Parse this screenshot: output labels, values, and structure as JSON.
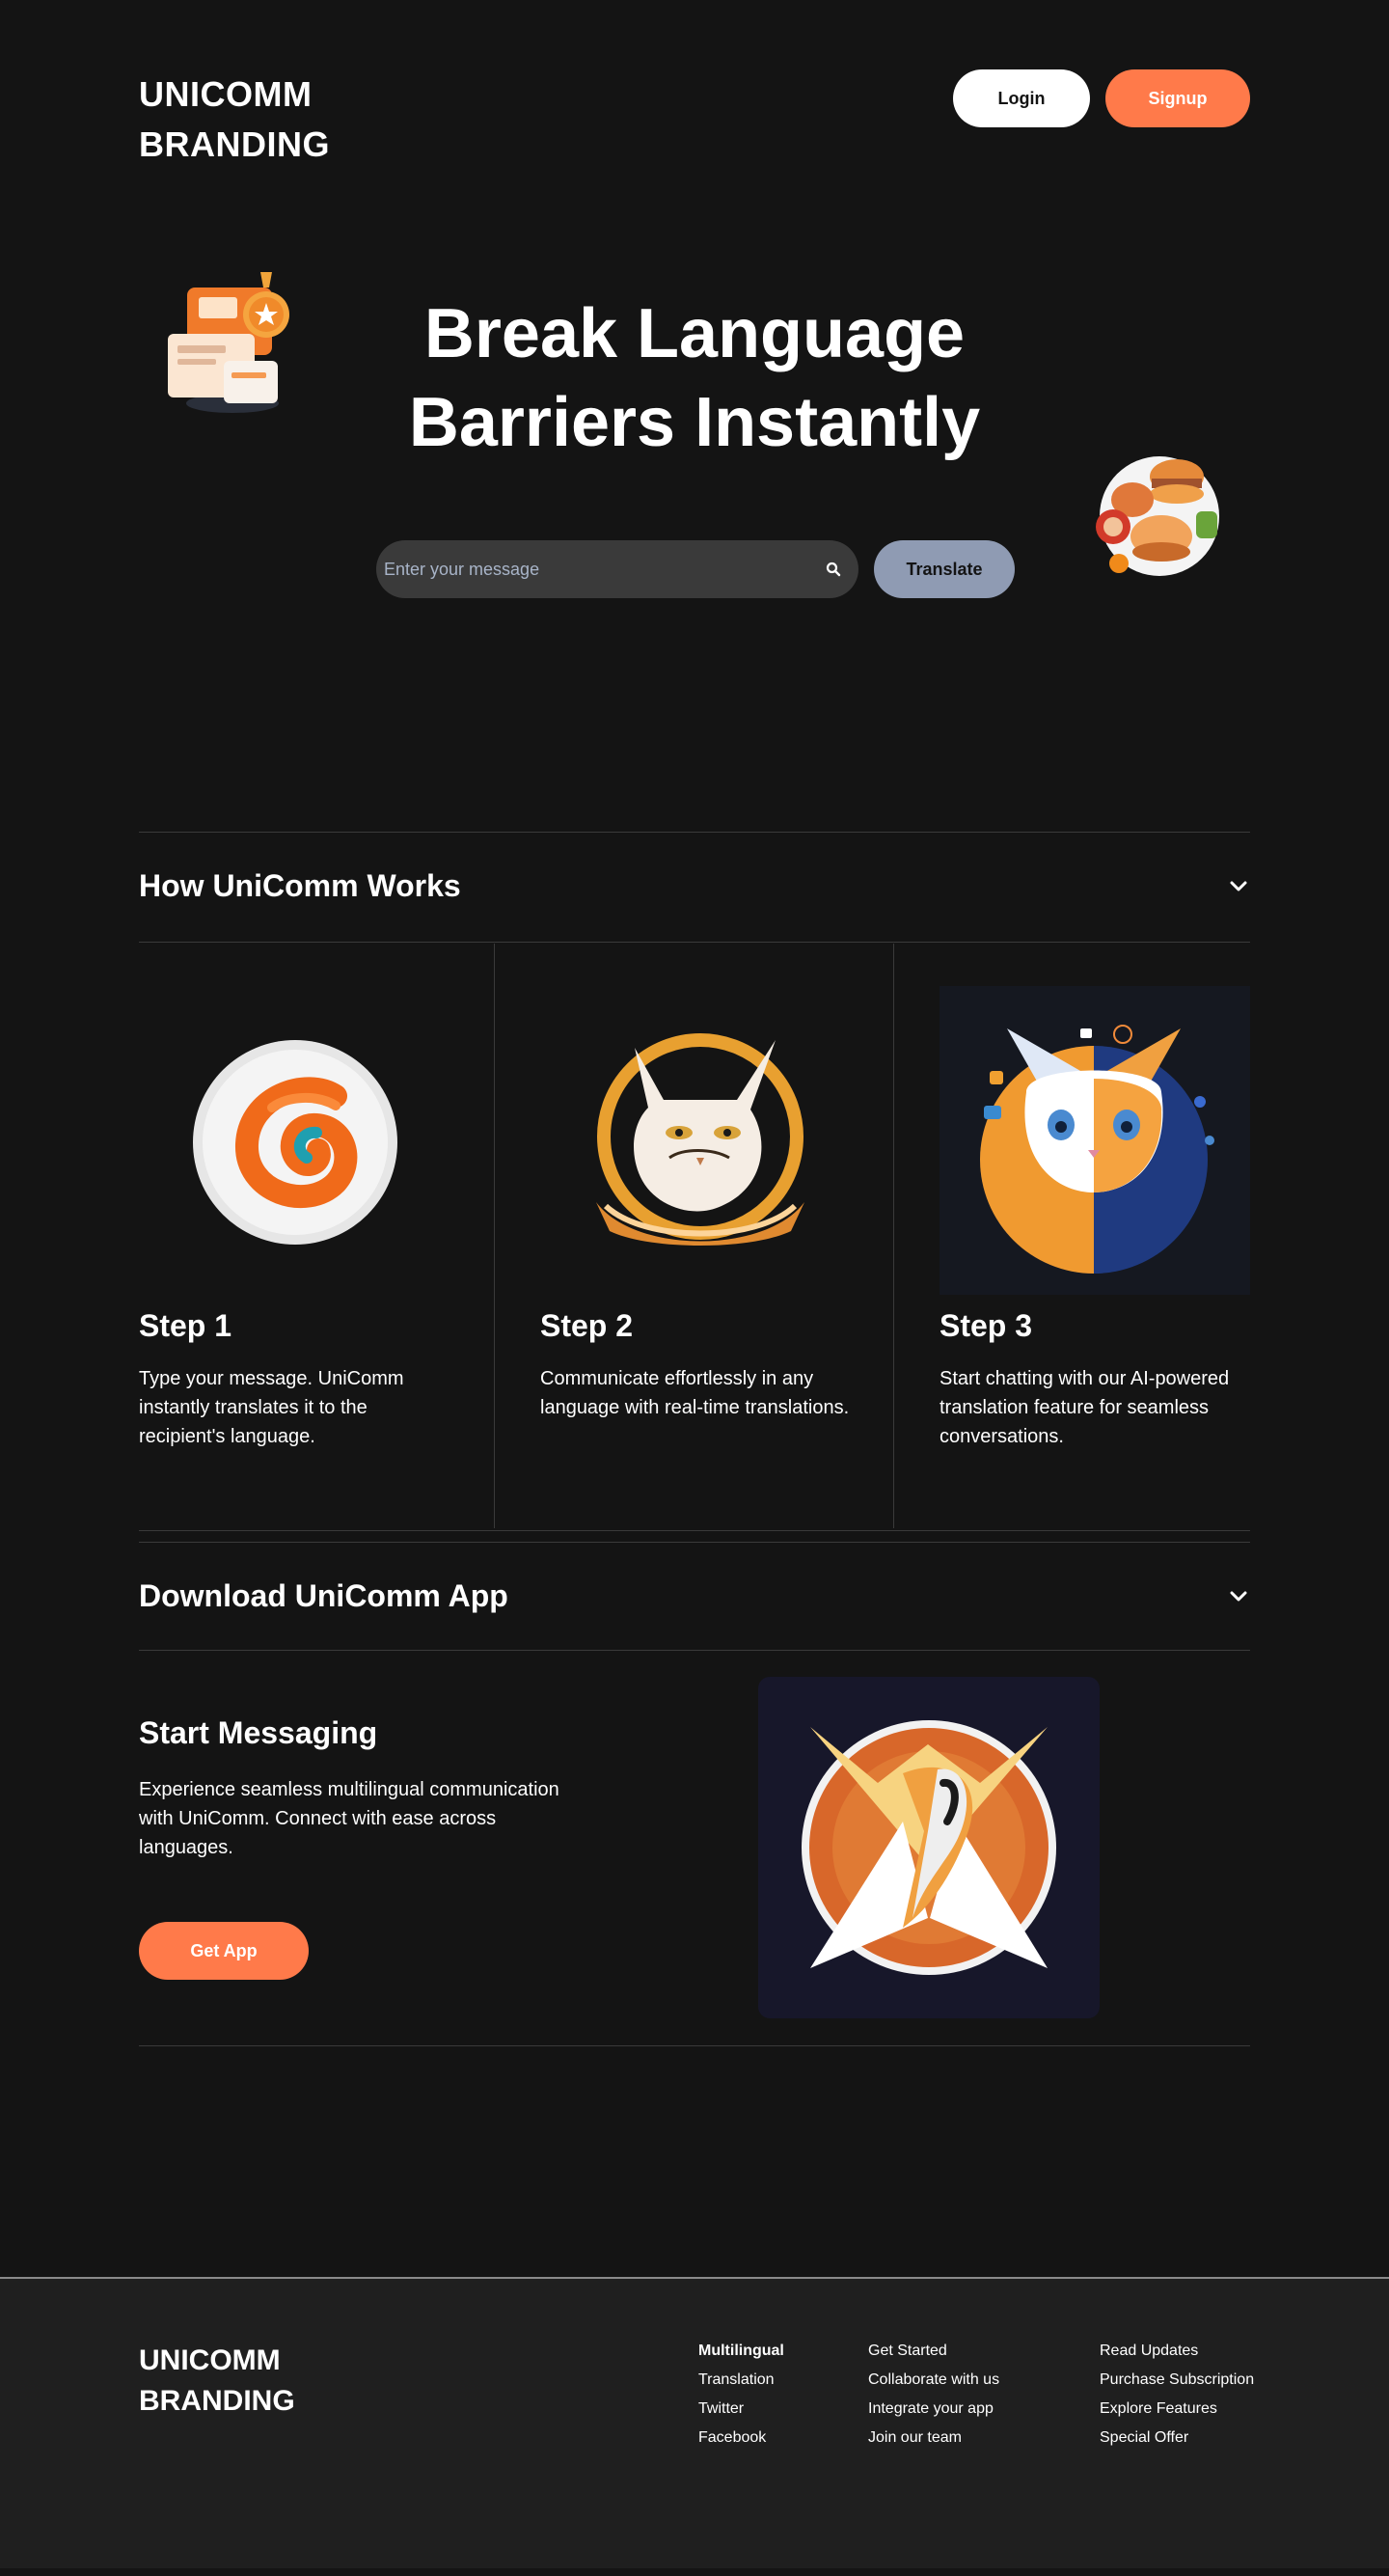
{
  "header": {
    "brand": "UNICOMM BRANDING",
    "login_label": "Login",
    "signup_label": "Signup"
  },
  "hero": {
    "title": "Break Language Barriers Instantly",
    "search_placeholder": "Enter your message",
    "translate_label": "Translate"
  },
  "how_it_works": {
    "title": "How UniComm Works",
    "steps": [
      {
        "title": "Step 1",
        "text": "Type your message. UniComm instantly translates it to the recipient's language."
      },
      {
        "title": "Step 2",
        "text": "Communicate effortlessly in any language with real-time translations."
      },
      {
        "title": "Step 3",
        "text": "Start chatting with our AI-powered translation feature for seamless conversations."
      }
    ]
  },
  "download": {
    "title": "Download UniComm App",
    "subtitle": "Start Messaging",
    "text": "Experience seamless multilingual communication with UniComm. Connect with ease across languages.",
    "button_label": "Get App"
  },
  "footer": {
    "brand": "UNICOMM BRANDING",
    "col1": [
      "Multilingual",
      "Translation",
      "Twitter",
      "Facebook"
    ],
    "col2": [
      "Get Started",
      "Collaborate with us",
      "Integrate your app",
      "Join our team"
    ],
    "col3": [
      "Read Updates",
      "Purchase Subscription",
      "Explore Features",
      "Special Offer"
    ]
  },
  "colors": {
    "background": "#141414",
    "accent": "#ff7a4a",
    "translate_button": "#8f9bb3",
    "footer_bg": "#1f1f1f"
  },
  "icons": {
    "search": "search-icon",
    "chevron": "chevron-down-icon"
  }
}
